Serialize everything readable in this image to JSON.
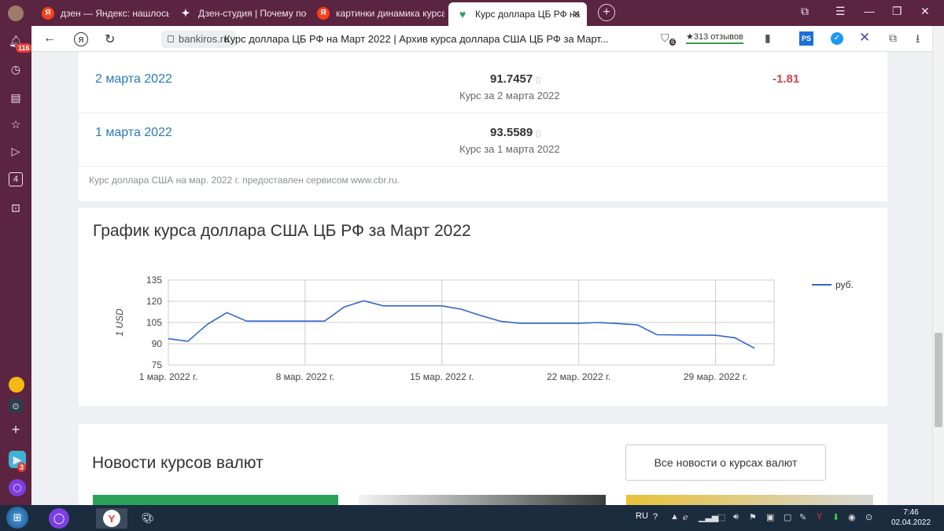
{
  "tabs": [
    {
      "label": "дзен — Яндекс: нашлось",
      "icon": "yandex-icon"
    },
    {
      "label": "Дзен-студия | Почему пос",
      "icon": "dzen-icon"
    },
    {
      "label": "картинки динамика курса",
      "icon": "yandex-icon"
    },
    {
      "label": "Курс доллара ЦБ РФ на",
      "icon": "bankiros-icon",
      "active": true
    }
  ],
  "address": {
    "domain": "bankiros.ru",
    "page_title": "Курс доллара ЦБ РФ на Март 2022 | Архив курса доллара США ЦБ РФ за Март...",
    "reviews": "★313 отзывов",
    "reviews_count": "6"
  },
  "sidebar": {
    "badge": "116",
    "tabs_count": "4",
    "app_badge": "3"
  },
  "rows": [
    {
      "date": "2 марта 2022",
      "value": "91.7457",
      "sub": "Курс за 2 марта 2022",
      "diff": "-1.81"
    },
    {
      "date": "1 марта 2022",
      "value": "93.5589",
      "sub": "Курс за 1 марта 2022",
      "diff": ""
    }
  ],
  "source_note": "Курс доллара США на мар. 2022 г. предоставлен сервисом www.cbr.ru.",
  "chart_title": "График курса доллара США ЦБ РФ за Март 2022",
  "chart_data": {
    "type": "line",
    "title": "График курса доллара США ЦБ РФ за Март 2022",
    "ylabel": "1 USD",
    "xlabel": "",
    "ylim": [
      75,
      135
    ],
    "yticks": [
      75,
      90,
      105,
      120,
      135
    ],
    "xticks": [
      {
        "day": 1,
        "label": "1 мар. 2022 г."
      },
      {
        "day": 8,
        "label": "8 мар. 2022 г."
      },
      {
        "day": 15,
        "label": "15 мар. 2022 г."
      },
      {
        "day": 22,
        "label": "22 мар. 2022 г."
      },
      {
        "day": 29,
        "label": "29 мар. 2022 г."
      }
    ],
    "xlim": [
      1,
      32
    ],
    "series": [
      {
        "name": "руб.",
        "color": "#3366cc",
        "x": [
          1,
          2,
          3,
          4,
          5,
          9,
          10,
          11,
          12,
          15,
          16,
          17,
          18,
          19,
          22,
          23,
          24,
          25,
          26,
          29,
          30,
          31
        ],
        "y": [
          93.56,
          91.75,
          103.8,
          112.0,
          106.0,
          106.0,
          116.0,
          120.4,
          116.8,
          116.8,
          114.4,
          109.9,
          105.9,
          104.5,
          104.5,
          105.0,
          104.3,
          103.4,
          96.4,
          96.0,
          94.2,
          86.8
        ]
      }
    ],
    "legend": "right",
    "grid": true
  },
  "news": {
    "title": "Новости курсов валют",
    "all_button": "Все новости о курсах валют"
  },
  "taskbar": {
    "lang": "RU",
    "time": "7:46",
    "date": "02.04.2022"
  }
}
